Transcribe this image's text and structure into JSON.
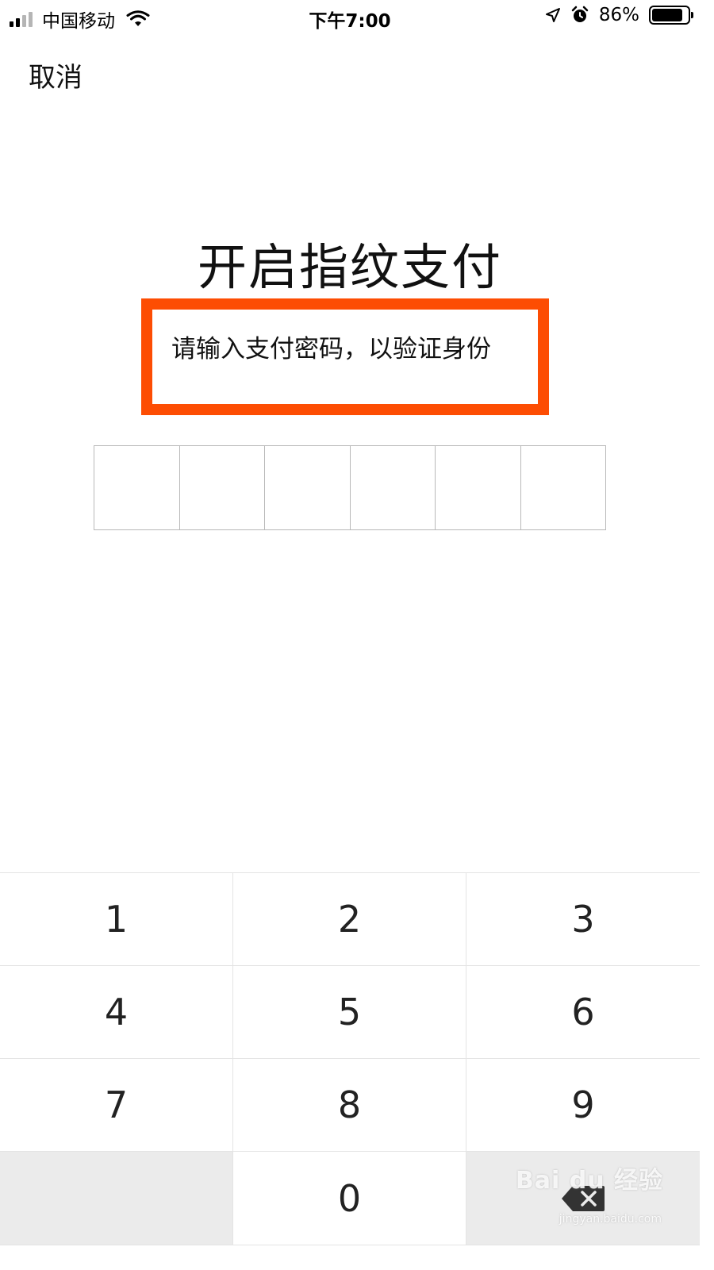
{
  "status_bar": {
    "carrier": "中国移动",
    "time": "下午7:00",
    "battery_percent": "86%",
    "battery_level": 0.86,
    "icons": [
      "signal-icon",
      "wifi-icon",
      "location-arrow-icon",
      "alarm-icon",
      "battery-icon"
    ]
  },
  "nav": {
    "cancel_label": "取消"
  },
  "main": {
    "title": "开启指纹支付",
    "subtitle": "请输入支付密码，以验证身份",
    "highlight_color": "#fd4d03",
    "pin_length": 6
  },
  "keypad": {
    "keys": [
      "1",
      "2",
      "3",
      "4",
      "5",
      "6",
      "7",
      "8",
      "9",
      "",
      "0",
      "backspace"
    ],
    "backspace_icon": "backspace-icon"
  },
  "watermark": {
    "brand": "Bai du 经验",
    "url": "jingyan.baidu.com"
  }
}
